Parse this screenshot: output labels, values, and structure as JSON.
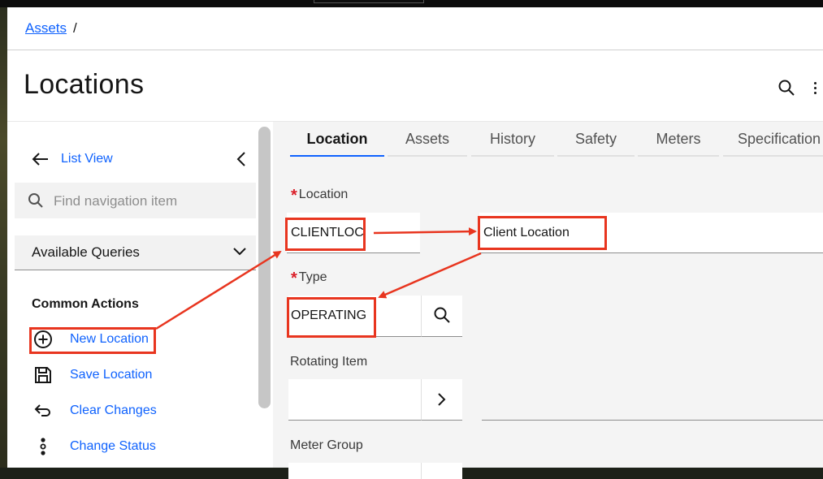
{
  "breadcrumb": {
    "link": "Assets",
    "separator": "/"
  },
  "page_title": "Locations",
  "header_icons": {
    "search": "search-icon",
    "more": "overflow-menu-icon"
  },
  "sidebar": {
    "list_view": "List View",
    "find_placeholder": "Find navigation item",
    "available_queries": "Available Queries",
    "common_actions_title": "Common Actions",
    "actions": [
      {
        "label": "New Location",
        "icon": "add-circle-icon"
      },
      {
        "label": "Save Location",
        "icon": "save-icon"
      },
      {
        "label": "Clear Changes",
        "icon": "undo-icon"
      },
      {
        "label": "Change Status",
        "icon": "traffic-light-icon"
      }
    ]
  },
  "tabs": [
    {
      "label": "Location",
      "active": true
    },
    {
      "label": "Assets"
    },
    {
      "label": "History"
    },
    {
      "label": "Safety"
    },
    {
      "label": "Meters"
    },
    {
      "label": "Specification"
    }
  ],
  "form": {
    "location_label": "Location",
    "location_value": "CLIENTLOC",
    "description_value": "Client Location",
    "type_label": "Type",
    "type_value": "OPERATING",
    "rotating_item_label": "Rotating Item",
    "meter_group_label": "Meter Group",
    "required_marker": "*"
  },
  "colors": {
    "accent": "#0f62fe",
    "annotation": "#e8351f",
    "required": "#da1e28"
  }
}
